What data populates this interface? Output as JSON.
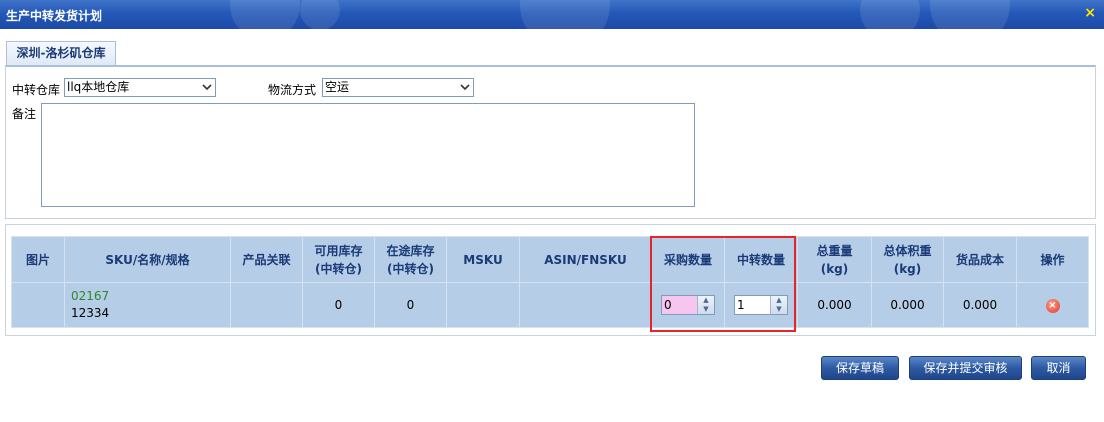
{
  "window": {
    "title": "生产中转发货计划",
    "close_glyph": "×"
  },
  "tab": {
    "label": "深圳-洛杉矶仓库"
  },
  "form": {
    "warehouse_label": "中转仓库",
    "warehouse_value": "llq本地仓库",
    "shipping_label": "物流方式",
    "shipping_value": "空运",
    "remark_label": "备注",
    "remark_value": ""
  },
  "grid": {
    "headers": {
      "image": "图片",
      "sku": "SKU/名称/规格",
      "related": "产品关联",
      "available_l1": "可用库存",
      "available_l2": "(中转仓)",
      "transit_l1": "在途库存",
      "transit_l2": "(中转仓)",
      "msku": "MSKU",
      "asin": "ASIN/FNSKU",
      "purchase_qty": "采购数量",
      "transfer_qty": "中转数量",
      "weight_l1": "总重量",
      "weight_l2": "(kg)",
      "volume_l1": "总体积重",
      "volume_l2": "(kg)",
      "cost": "货品成本",
      "action": "操作"
    },
    "rows": [
      {
        "sku_code": "02167",
        "sku_name": "12334",
        "related": "",
        "available": "0",
        "in_transit": "0",
        "msku": "",
        "asin": "",
        "purchase_qty": "0",
        "transfer_qty": "1",
        "weight": "0.000",
        "volume": "0.000",
        "cost": "0.000"
      }
    ]
  },
  "buttons": {
    "save_draft": "保存草稿",
    "save_submit": "保存并提交审核",
    "cancel": "取消"
  },
  "colors": {
    "titlebar": "#2458b8",
    "header": "#b6cde7",
    "highlight": "#e8232a",
    "sku_code": "#2a8a2a"
  }
}
